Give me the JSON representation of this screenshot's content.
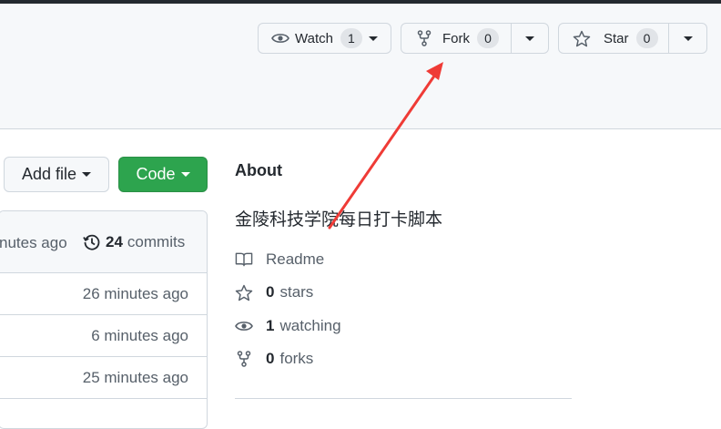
{
  "header": {
    "watch": {
      "label": "Watch",
      "count": "1"
    },
    "fork": {
      "label": "Fork",
      "count": "0"
    },
    "star": {
      "label": "Star",
      "count": "0"
    }
  },
  "toolbar": {
    "add_file_label": "Add file",
    "code_label": "Code"
  },
  "commits": {
    "latest_time": "nutes ago",
    "count": "24",
    "label": "commits"
  },
  "file_rows": [
    {
      "time": "26 minutes ago"
    },
    {
      "time": "6 minutes ago"
    },
    {
      "time": "25 minutes ago"
    }
  ],
  "about": {
    "title": "About",
    "description": "金陵科技学院每日打卡脚本",
    "readme": "Readme",
    "stars_count": "0",
    "stars_label": "stars",
    "watching_count": "1",
    "watching_label": "watching",
    "forks_count": "0",
    "forks_label": "forks"
  },
  "annotation": {
    "color": "#ef3b36",
    "icon": "red-arrow"
  },
  "colors": {
    "code_button": "#2da44e",
    "border": "#d0d7de",
    "muted": "#57606a"
  }
}
